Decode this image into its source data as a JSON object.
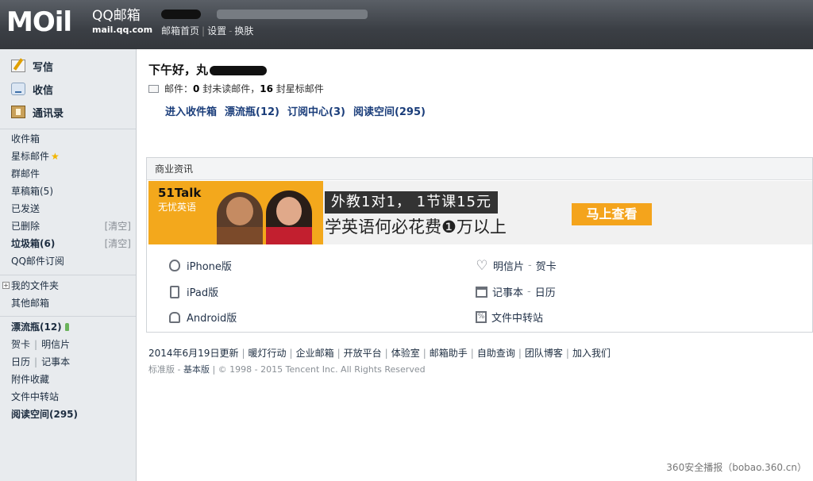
{
  "header": {
    "logo_text": "MOil",
    "brand": "QQ邮箱",
    "domain": "mail.qq.com",
    "links": [
      "邮箱首页",
      "设置",
      "换肤"
    ],
    "links_sep_dash": "-"
  },
  "sidebar": {
    "primary": [
      {
        "label": "写信",
        "icon": "write-icon"
      },
      {
        "label": "收信",
        "icon": "inbox-icon"
      },
      {
        "label": "通讯录",
        "icon": "contacts-icon"
      }
    ],
    "folders": [
      {
        "label": "收件箱"
      },
      {
        "label": "星标邮件"
      },
      {
        "label": "群邮件"
      },
      {
        "label": "草稿箱(5)"
      },
      {
        "label": "已发送"
      },
      {
        "label": "已删除",
        "action": "[清空]"
      },
      {
        "label": "垃圾箱(6)",
        "action": "[清空]"
      },
      {
        "label": "QQ邮件订阅"
      }
    ],
    "my_folders": "我的文件夹",
    "other_folders": "其他邮箱",
    "apps": {
      "bottle": "漂流瓶(12)",
      "card": "贺卡",
      "postcard": "明信片",
      "calendar": "日历",
      "notebook": "记事本",
      "attachments": "附件收藏",
      "transfer": "文件中转站",
      "reading": "阅读空间(295)"
    }
  },
  "main": {
    "greeting": "下午好，丸",
    "summary": {
      "label": "邮件：",
      "unread_count": "0",
      "unread_text": "封未读邮件，",
      "starred_count": "16",
      "starred_text": "封星标邮件"
    },
    "quick_links": [
      "进入收件箱",
      "漂流瓶(12)",
      "订阅中心(3)",
      "阅读空间(295)"
    ]
  },
  "business": {
    "title": "商业资讯",
    "banner": {
      "brand": "51Talk",
      "brand_sub": "无忧英语",
      "line1": "外教1对1， 1节课15元",
      "line2": "学英语何必花费❶万以上",
      "cta": "马上查看"
    },
    "services_left": [
      "iPhone版",
      "iPad版",
      "Android版"
    ],
    "services_right": [
      {
        "a": "明信片",
        "b": "贺卡"
      },
      {
        "a": "记事本",
        "b": "日历"
      },
      {
        "a": "文件中转站",
        "b": ""
      }
    ]
  },
  "footer": {
    "links": [
      "2014年6月19日更新",
      "暖灯行动",
      "企业邮箱",
      "开放平台",
      "体验室",
      "邮箱助手",
      "自助查询",
      "团队博客",
      "加入我们"
    ],
    "version_standard": "标准版",
    "version_basic": "基本版",
    "copyright": "| © 1998 - 2015 Tencent Inc. All Rights Reserved"
  },
  "watermark": "360安全播报（bobao.360.cn）"
}
